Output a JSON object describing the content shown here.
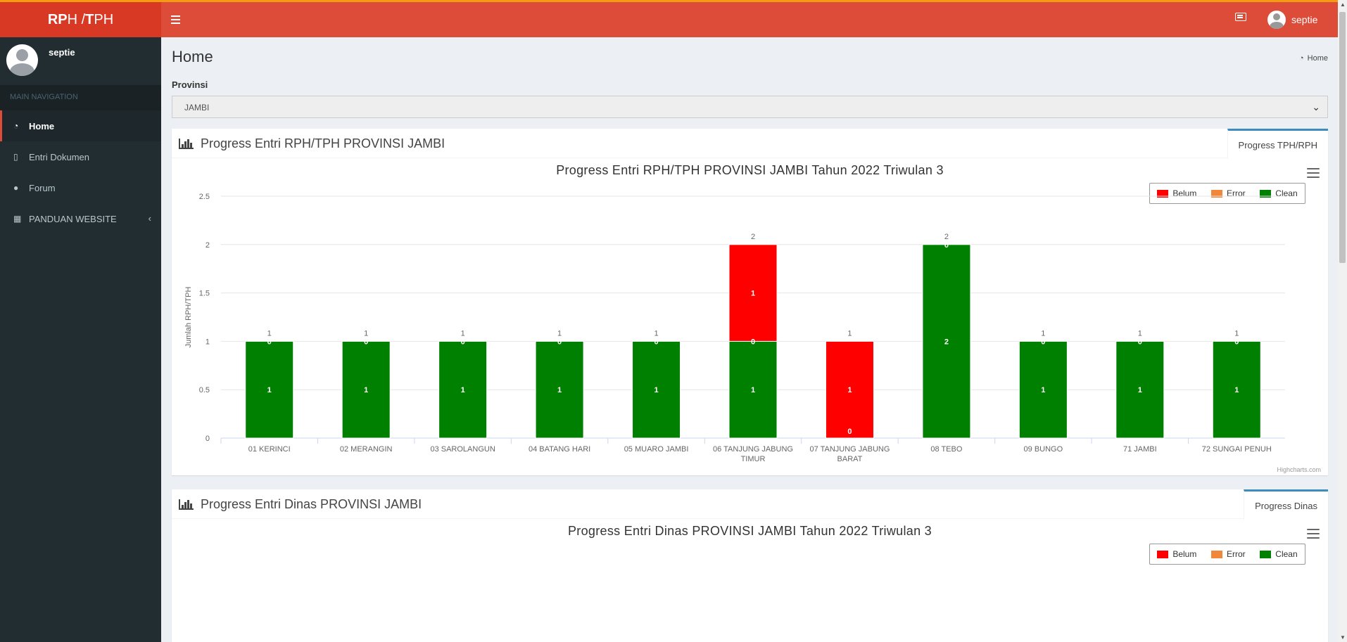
{
  "app": {
    "logo_bold_1": "RP",
    "logo_rest": "H / ",
    "logo_bold_2": "T",
    "logo_rest_2": "PH"
  },
  "header": {
    "username": "septie"
  },
  "sidebar": {
    "username": "septie",
    "nav_header": "MAIN NAVIGATION",
    "items": [
      {
        "label": "Home",
        "icon": "dashboard-icon"
      },
      {
        "label": "Entri Dokumen",
        "icon": "file-icon"
      },
      {
        "label": "Forum",
        "icon": "comments-icon"
      },
      {
        "label": "PANDUAN WEBSITE",
        "icon": "table-icon"
      }
    ]
  },
  "page": {
    "title": "Home",
    "breadcrumb": "Home"
  },
  "filter": {
    "label": "Provinsi",
    "selected": "JAMBI"
  },
  "colors": {
    "belum": "#ff0000",
    "error": "#f0873a",
    "clean": "#008000",
    "accent": "#dd4b39"
  },
  "legend": [
    "Belum",
    "Error",
    "Clean"
  ],
  "panel1": {
    "title": "Progress Entri RPH/TPH PROVINSI JAMBI",
    "tab": "Progress TPH/RPH",
    "chart_title": "Progress Entri RPH/TPH PROVINSI JAMBI Tahun 2022 Triwulan 3",
    "credits": "Highcharts.com"
  },
  "panel2": {
    "title": "Progress Entri Dinas PROVINSI JAMBI",
    "tab": "Progress Dinas",
    "chart_title": "Progress Entri Dinas PROVINSI JAMBI Tahun 2022 Triwulan 3"
  },
  "chart_data": {
    "type": "bar",
    "stacked": true,
    "title": "Progress Entri RPH/TPH PROVINSI JAMBI Tahun 2022 Triwulan 3",
    "ylabel": "Jumlah RPH/TPH",
    "ylim": [
      0,
      2.5
    ],
    "yticks": [
      "0",
      "0.5",
      "1",
      "1.5",
      "2",
      "2.5"
    ],
    "categories": [
      [
        "01 KERINCI"
      ],
      [
        "02 MERANGIN"
      ],
      [
        "03 SAROLANGUN"
      ],
      [
        "04 BATANG HARI"
      ],
      [
        "05 MUARO JAMBI"
      ],
      [
        "06 TANJUNG JABUNG",
        "TIMUR"
      ],
      [
        "07 TANJUNG JABUNG",
        "BARAT"
      ],
      [
        "08 TEBO"
      ],
      [
        "09 BUNGO"
      ],
      [
        "71 JAMBI"
      ],
      [
        "72 SUNGAI PENUH"
      ]
    ],
    "series": [
      {
        "name": "Belum",
        "values": [
          0,
          0,
          0,
          0,
          0,
          1,
          1,
          0,
          0,
          0,
          0
        ]
      },
      {
        "name": "Error",
        "values": [
          0,
          0,
          0,
          0,
          0,
          0,
          0,
          0,
          0,
          0,
          0
        ]
      },
      {
        "name": "Clean",
        "values": [
          1,
          1,
          1,
          1,
          1,
          1,
          0,
          2,
          1,
          1,
          1
        ]
      }
    ],
    "totals": [
      1,
      1,
      1,
      1,
      1,
      2,
      1,
      2,
      1,
      1,
      1
    ],
    "legend_position": "top-right",
    "grid": true
  }
}
